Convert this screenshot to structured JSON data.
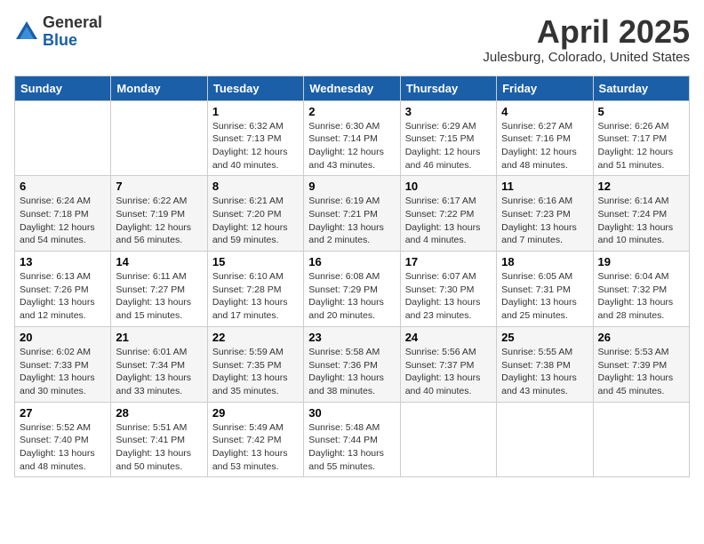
{
  "logo": {
    "general": "General",
    "blue": "Blue"
  },
  "title": "April 2025",
  "location": "Julesburg, Colorado, United States",
  "weekdays": [
    "Sunday",
    "Monday",
    "Tuesday",
    "Wednesday",
    "Thursday",
    "Friday",
    "Saturday"
  ],
  "weeks": [
    [
      {
        "day": "",
        "sunrise": "",
        "sunset": "",
        "daylight": ""
      },
      {
        "day": "",
        "sunrise": "",
        "sunset": "",
        "daylight": ""
      },
      {
        "day": "1",
        "sunrise": "Sunrise: 6:32 AM",
        "sunset": "Sunset: 7:13 PM",
        "daylight": "Daylight: 12 hours and 40 minutes."
      },
      {
        "day": "2",
        "sunrise": "Sunrise: 6:30 AM",
        "sunset": "Sunset: 7:14 PM",
        "daylight": "Daylight: 12 hours and 43 minutes."
      },
      {
        "day": "3",
        "sunrise": "Sunrise: 6:29 AM",
        "sunset": "Sunset: 7:15 PM",
        "daylight": "Daylight: 12 hours and 46 minutes."
      },
      {
        "day": "4",
        "sunrise": "Sunrise: 6:27 AM",
        "sunset": "Sunset: 7:16 PM",
        "daylight": "Daylight: 12 hours and 48 minutes."
      },
      {
        "day": "5",
        "sunrise": "Sunrise: 6:26 AM",
        "sunset": "Sunset: 7:17 PM",
        "daylight": "Daylight: 12 hours and 51 minutes."
      }
    ],
    [
      {
        "day": "6",
        "sunrise": "Sunrise: 6:24 AM",
        "sunset": "Sunset: 7:18 PM",
        "daylight": "Daylight: 12 hours and 54 minutes."
      },
      {
        "day": "7",
        "sunrise": "Sunrise: 6:22 AM",
        "sunset": "Sunset: 7:19 PM",
        "daylight": "Daylight: 12 hours and 56 minutes."
      },
      {
        "day": "8",
        "sunrise": "Sunrise: 6:21 AM",
        "sunset": "Sunset: 7:20 PM",
        "daylight": "Daylight: 12 hours and 59 minutes."
      },
      {
        "day": "9",
        "sunrise": "Sunrise: 6:19 AM",
        "sunset": "Sunset: 7:21 PM",
        "daylight": "Daylight: 13 hours and 2 minutes."
      },
      {
        "day": "10",
        "sunrise": "Sunrise: 6:17 AM",
        "sunset": "Sunset: 7:22 PM",
        "daylight": "Daylight: 13 hours and 4 minutes."
      },
      {
        "day": "11",
        "sunrise": "Sunrise: 6:16 AM",
        "sunset": "Sunset: 7:23 PM",
        "daylight": "Daylight: 13 hours and 7 minutes."
      },
      {
        "day": "12",
        "sunrise": "Sunrise: 6:14 AM",
        "sunset": "Sunset: 7:24 PM",
        "daylight": "Daylight: 13 hours and 10 minutes."
      }
    ],
    [
      {
        "day": "13",
        "sunrise": "Sunrise: 6:13 AM",
        "sunset": "Sunset: 7:26 PM",
        "daylight": "Daylight: 13 hours and 12 minutes."
      },
      {
        "day": "14",
        "sunrise": "Sunrise: 6:11 AM",
        "sunset": "Sunset: 7:27 PM",
        "daylight": "Daylight: 13 hours and 15 minutes."
      },
      {
        "day": "15",
        "sunrise": "Sunrise: 6:10 AM",
        "sunset": "Sunset: 7:28 PM",
        "daylight": "Daylight: 13 hours and 17 minutes."
      },
      {
        "day": "16",
        "sunrise": "Sunrise: 6:08 AM",
        "sunset": "Sunset: 7:29 PM",
        "daylight": "Daylight: 13 hours and 20 minutes."
      },
      {
        "day": "17",
        "sunrise": "Sunrise: 6:07 AM",
        "sunset": "Sunset: 7:30 PM",
        "daylight": "Daylight: 13 hours and 23 minutes."
      },
      {
        "day": "18",
        "sunrise": "Sunrise: 6:05 AM",
        "sunset": "Sunset: 7:31 PM",
        "daylight": "Daylight: 13 hours and 25 minutes."
      },
      {
        "day": "19",
        "sunrise": "Sunrise: 6:04 AM",
        "sunset": "Sunset: 7:32 PM",
        "daylight": "Daylight: 13 hours and 28 minutes."
      }
    ],
    [
      {
        "day": "20",
        "sunrise": "Sunrise: 6:02 AM",
        "sunset": "Sunset: 7:33 PM",
        "daylight": "Daylight: 13 hours and 30 minutes."
      },
      {
        "day": "21",
        "sunrise": "Sunrise: 6:01 AM",
        "sunset": "Sunset: 7:34 PM",
        "daylight": "Daylight: 13 hours and 33 minutes."
      },
      {
        "day": "22",
        "sunrise": "Sunrise: 5:59 AM",
        "sunset": "Sunset: 7:35 PM",
        "daylight": "Daylight: 13 hours and 35 minutes."
      },
      {
        "day": "23",
        "sunrise": "Sunrise: 5:58 AM",
        "sunset": "Sunset: 7:36 PM",
        "daylight": "Daylight: 13 hours and 38 minutes."
      },
      {
        "day": "24",
        "sunrise": "Sunrise: 5:56 AM",
        "sunset": "Sunset: 7:37 PM",
        "daylight": "Daylight: 13 hours and 40 minutes."
      },
      {
        "day": "25",
        "sunrise": "Sunrise: 5:55 AM",
        "sunset": "Sunset: 7:38 PM",
        "daylight": "Daylight: 13 hours and 43 minutes."
      },
      {
        "day": "26",
        "sunrise": "Sunrise: 5:53 AM",
        "sunset": "Sunset: 7:39 PM",
        "daylight": "Daylight: 13 hours and 45 minutes."
      }
    ],
    [
      {
        "day": "27",
        "sunrise": "Sunrise: 5:52 AM",
        "sunset": "Sunset: 7:40 PM",
        "daylight": "Daylight: 13 hours and 48 minutes."
      },
      {
        "day": "28",
        "sunrise": "Sunrise: 5:51 AM",
        "sunset": "Sunset: 7:41 PM",
        "daylight": "Daylight: 13 hours and 50 minutes."
      },
      {
        "day": "29",
        "sunrise": "Sunrise: 5:49 AM",
        "sunset": "Sunset: 7:42 PM",
        "daylight": "Daylight: 13 hours and 53 minutes."
      },
      {
        "day": "30",
        "sunrise": "Sunrise: 5:48 AM",
        "sunset": "Sunset: 7:44 PM",
        "daylight": "Daylight: 13 hours and 55 minutes."
      },
      {
        "day": "",
        "sunrise": "",
        "sunset": "",
        "daylight": ""
      },
      {
        "day": "",
        "sunrise": "",
        "sunset": "",
        "daylight": ""
      },
      {
        "day": "",
        "sunrise": "",
        "sunset": "",
        "daylight": ""
      }
    ]
  ]
}
